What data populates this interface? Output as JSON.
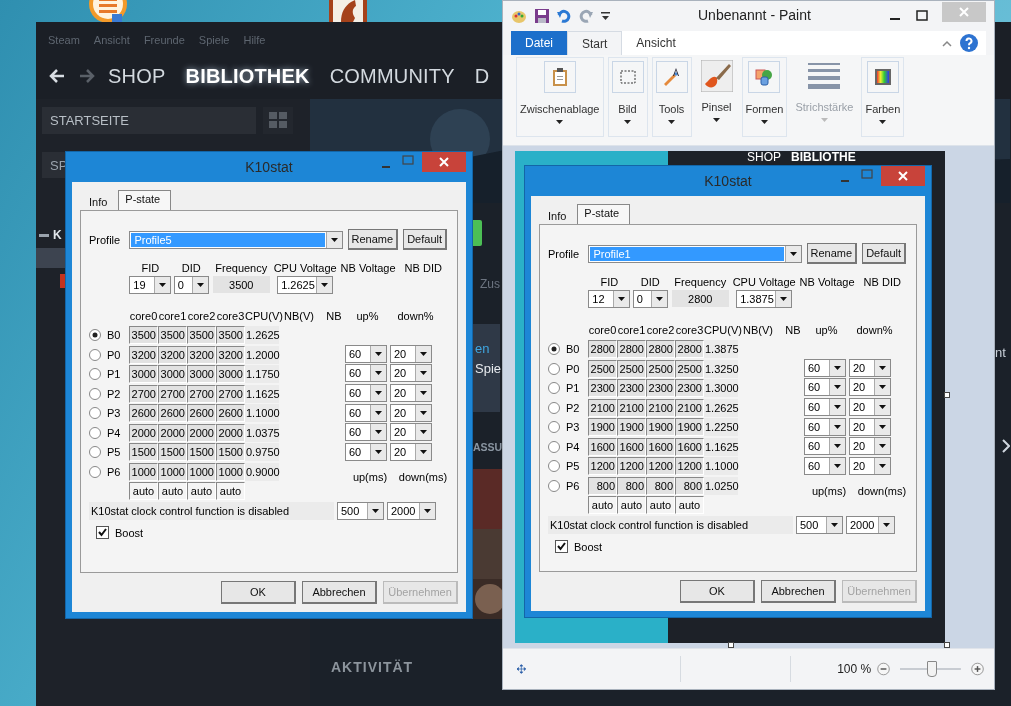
{
  "steam": {
    "menu": [
      "Steam",
      "Ansicht",
      "Freunde",
      "Spiele",
      "Hilfe"
    ],
    "nav": [
      {
        "label": "SHOP",
        "selected": false
      },
      {
        "label": "BIBLIOTHEK",
        "selected": true
      },
      {
        "label": "COMMUNITY",
        "selected": false
      },
      {
        "label": "D",
        "selected": false
      }
    ],
    "home": "STARTSEITE",
    "search_value": "SP",
    "section": "K",
    "tab_fragment": "Zus",
    "banner_link": "en",
    "banner_text": "Spie",
    "section_heading": "ASSU",
    "activity_heading": "AKTIVITÄT",
    "edge_text": "nt"
  },
  "dialogs": [
    {
      "title": "K10stat",
      "tabs": [
        {
          "label": "Info",
          "selected": false
        },
        {
          "label": "P-state",
          "selected": true
        }
      ],
      "profile_label": "Profile",
      "profile": "Profile5",
      "rename": "Rename",
      "default": "Default",
      "field_labels": [
        "FID",
        "DID",
        "Frequency",
        "CPU Voltage",
        "NB Voltage",
        "NB DID"
      ],
      "fid": "19",
      "did": "0",
      "frequency": "3500",
      "cpu_voltage": "1.2625",
      "columns": [
        "core0",
        "core1",
        "core2",
        "core3",
        "CPU(V)",
        "NB(V)",
        "NB"
      ],
      "rate_columns": [
        "up%",
        "down%"
      ],
      "pstates": [
        {
          "label": "B0",
          "selected": true,
          "cores": [
            "3500",
            "3500",
            "3500",
            "3500"
          ],
          "cpu_v": "1.2625"
        },
        {
          "label": "P0",
          "selected": false,
          "cores": [
            "3200",
            "3200",
            "3200",
            "3200"
          ],
          "cpu_v": "1.2000"
        },
        {
          "label": "P1",
          "selected": false,
          "cores": [
            "3000",
            "3000",
            "3000",
            "3000"
          ],
          "cpu_v": "1.1750"
        },
        {
          "label": "P2",
          "selected": false,
          "cores": [
            "2700",
            "2700",
            "2700",
            "2700"
          ],
          "cpu_v": "1.1625"
        },
        {
          "label": "P3",
          "selected": false,
          "cores": [
            "2600",
            "2600",
            "2600",
            "2600"
          ],
          "cpu_v": "1.1000"
        },
        {
          "label": "P4",
          "selected": false,
          "cores": [
            "2000",
            "2000",
            "2000",
            "2000"
          ],
          "cpu_v": "1.0375"
        },
        {
          "label": "P5",
          "selected": false,
          "cores": [
            "1500",
            "1500",
            "1500",
            "1500"
          ],
          "cpu_v": "0.9750"
        },
        {
          "label": "P6",
          "selected": false,
          "cores": [
            "1000",
            "1000",
            "1000",
            "1000"
          ],
          "cpu_v": "0.9000"
        }
      ],
      "auto": [
        "auto",
        "auto",
        "auto",
        "auto"
      ],
      "rates": [
        {
          "up": "60",
          "down": "20"
        },
        {
          "up": "60",
          "down": "20"
        },
        {
          "up": "60",
          "down": "20"
        },
        {
          "up": "60",
          "down": "20"
        },
        {
          "up": "60",
          "down": "20"
        },
        {
          "up": "60",
          "down": "20"
        }
      ],
      "ms_labels": [
        "up(ms)",
        "down(ms)"
      ],
      "up_ms": "500",
      "down_ms": "2000",
      "status": "K10stat clock control function is disabled",
      "boost": {
        "label": "Boost",
        "checked": true
      },
      "buttons": [
        {
          "label": "OK",
          "disabled": false
        },
        {
          "label": "Abbrechen",
          "disabled": false
        },
        {
          "label": "Übernehmen",
          "disabled": true
        }
      ]
    },
    {
      "title": "K10stat",
      "tabs": [
        {
          "label": "Info",
          "selected": false
        },
        {
          "label": "P-state",
          "selected": true
        }
      ],
      "profile_label": "Profile",
      "profile": "Profile1",
      "rename": "Rename",
      "default": "Default",
      "field_labels": [
        "FID",
        "DID",
        "Frequency",
        "CPU Voltage",
        "NB Voltage",
        "NB DID"
      ],
      "fid": "12",
      "did": "0",
      "frequency": "2800",
      "cpu_voltage": "1.3875",
      "columns": [
        "core0",
        "core1",
        "core2",
        "core3",
        "CPU(V)",
        "NB(V)",
        "NB"
      ],
      "rate_columns": [
        "up%",
        "down%"
      ],
      "pstates": [
        {
          "label": "B0",
          "selected": true,
          "cores": [
            "2800",
            "2800",
            "2800",
            "2800"
          ],
          "cpu_v": "1.3875"
        },
        {
          "label": "P0",
          "selected": false,
          "cores": [
            "2500",
            "2500",
            "2500",
            "2500"
          ],
          "cpu_v": "1.3250"
        },
        {
          "label": "P1",
          "selected": false,
          "cores": [
            "2300",
            "2300",
            "2300",
            "2300"
          ],
          "cpu_v": "1.3000"
        },
        {
          "label": "P2",
          "selected": false,
          "cores": [
            "2100",
            "2100",
            "2100",
            "2100"
          ],
          "cpu_v": "1.2625"
        },
        {
          "label": "P3",
          "selected": false,
          "cores": [
            "1900",
            "1900",
            "1900",
            "1900"
          ],
          "cpu_v": "1.2250"
        },
        {
          "label": "P4",
          "selected": false,
          "cores": [
            "1600",
            "1600",
            "1600",
            "1600"
          ],
          "cpu_v": "1.1625"
        },
        {
          "label": "P5",
          "selected": false,
          "cores": [
            "1200",
            "1200",
            "1200",
            "1200"
          ],
          "cpu_v": "1.1000"
        },
        {
          "label": "P6",
          "selected": false,
          "cores": [
            "800",
            "800",
            "800",
            "800"
          ],
          "cpu_v": "1.0250"
        }
      ],
      "auto": [
        "auto",
        "auto",
        "auto",
        "auto"
      ],
      "rates": [
        {
          "up": "60",
          "down": "20"
        },
        {
          "up": "60",
          "down": "20"
        },
        {
          "up": "60",
          "down": "20"
        },
        {
          "up": "60",
          "down": "20"
        },
        {
          "up": "60",
          "down": "20"
        },
        {
          "up": "60",
          "down": "20"
        }
      ],
      "ms_labels": [
        "up(ms)",
        "down(ms)"
      ],
      "up_ms": "500",
      "down_ms": "2000",
      "status": "K10stat clock control function is disabled",
      "boost": {
        "label": "Boost",
        "checked": true
      },
      "buttons": [
        {
          "label": "OK",
          "disabled": false
        },
        {
          "label": "Abbrechen",
          "disabled": false
        },
        {
          "label": "Übernehmen",
          "disabled": true
        }
      ]
    }
  ],
  "paint": {
    "title": "Unbenannt - Paint",
    "file_tab": "Datei",
    "tabs": [
      {
        "label": "Start",
        "selected": true
      },
      {
        "label": "Ansicht",
        "selected": false
      }
    ],
    "groups": [
      {
        "label": "Zwischenablage",
        "kind": "clipboard",
        "disabled": false
      },
      {
        "label": "Bild",
        "disabled": false
      },
      {
        "label": "Tools",
        "kind": "tools",
        "disabled": false
      },
      {
        "label": "Pinsel",
        "kind": "brush",
        "disabled": false
      },
      {
        "label": "Formen",
        "kind": "shapes",
        "disabled": false
      },
      {
        "label": "Strichstärke",
        "kind": "stroke",
        "disabled": true
      },
      {
        "label": "Farben",
        "kind": "colors",
        "disabled": false
      }
    ],
    "canvas_nav": [
      "SHOP",
      "BIBLIOTHE"
    ],
    "zoom": "100 %",
    "zoom_slider": {
      "level": 0.5
    }
  }
}
